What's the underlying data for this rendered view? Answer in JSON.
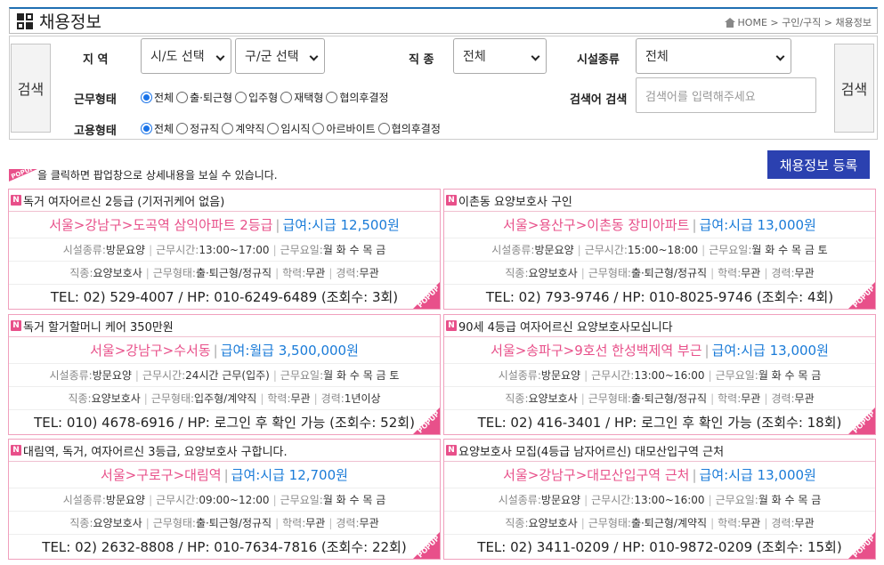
{
  "header": {
    "title": "채용정보",
    "breadcrumb": "HOME > 구인/구직 > 채용정보"
  },
  "search": {
    "button_label": "검색",
    "region_label": "지 역",
    "region_sido": "시/도 선택",
    "region_gugun": "구/군 선택",
    "job_label": "직 종",
    "job_value": "전체",
    "facility_label": "시설종류",
    "facility_value": "전체",
    "worktype_label": "근무형태",
    "worktype_options": [
      "전체",
      "출·퇴근형",
      "입주형",
      "재택형",
      "협의후결정"
    ],
    "keyword_label": "검색어 검색",
    "keyword_placeholder": "검색어를 입력해주세요",
    "employ_label": "고용형태",
    "employ_options": [
      "전체",
      "정규직",
      "계약직",
      "임시직",
      "아르바이트",
      "협의후결정"
    ]
  },
  "notice": "을 클릭하면 팝업창으로 상세내용을 보실 수 있습니다.",
  "popup_badge": "POPUP",
  "register_button": "채용정보 등록",
  "field_labels": {
    "facility": "시설종류:",
    "hours": "근무시간:",
    "days": "근무요일:",
    "job": "직종:",
    "worktype": "근무형태:",
    "edu": "학력:",
    "career": "경력:"
  },
  "new_badge": "N",
  "colors": {
    "accent_pink": "#e8508a",
    "wage_blue": "#1a7bd8",
    "register_bg": "#2b41b0"
  },
  "cards": [
    {
      "title": "독거 여자어르신 2등급 (기저귀케어 없음)",
      "location": "서울>강남구>도곡역 삼익아파트 2등급",
      "wage": "급여:시급 12,500원",
      "facility": "방문요양",
      "hours": "13:00~17:00",
      "days": "월 화 수 목 금",
      "job": "요양보호사",
      "worktype": "출·퇴근형/정규직",
      "edu": "무관",
      "career": "무관",
      "tel": "TEL: 02) 529-4007 / HP: 010-6249-6489 (조회수: 3회)"
    },
    {
      "title": "이촌동 요양보호사 구인",
      "location": "서울>용산구>이촌동 장미아파트",
      "wage": "급여:시급 13,000원",
      "facility": "방문요양",
      "hours": "15:00~18:00",
      "days": "월 화 수 목 금 토",
      "job": "요양보호사",
      "worktype": "출·퇴근형/정규직",
      "edu": "무관",
      "career": "무관",
      "tel": "TEL: 02) 793-9746 / HP: 010-8025-9746 (조회수: 4회)"
    },
    {
      "title": "독거 할거할머니 케어 350만원",
      "location": "서울>강남구>수서동",
      "wage": "급여:월급 3,500,000원",
      "facility": "방문요양",
      "hours": "24시간 근무(입주)",
      "days": "월 화 수 목 금 토",
      "job": "요양보호사",
      "worktype": "입주형/계약직",
      "edu": "무관",
      "career": "1년이상",
      "tel": "TEL: 010) 4678-6916 / HP: 로그인 후 확인 가능 (조회수: 52회)"
    },
    {
      "title": "90세 4등급 여자어르신 요양보호사모십니다",
      "location": "서울>송파구>9호선 한성백제역 부근",
      "wage": "급여:시급 13,000원",
      "facility": "방문요양",
      "hours": "13:00~16:00",
      "days": "월 화 수 목 금",
      "job": "요양보호사",
      "worktype": "출·퇴근형/정규직",
      "edu": "무관",
      "career": "무관",
      "tel": "TEL: 02) 416-3401 / HP: 로그인 후 확인 가능 (조회수: 18회)"
    },
    {
      "title": "대림역, 독거, 여자어르신 3등급, 요양보호사 구합니다.",
      "location": "서울>구로구>대림역",
      "wage": "급여:시급 12,700원",
      "facility": "방문요양",
      "hours": "09:00~12:00",
      "days": "월 화 수 목 금",
      "job": "요양보호사",
      "worktype": "출·퇴근형/정규직",
      "edu": "무관",
      "career": "무관",
      "tel": "TEL: 02) 2632-8808 / HP: 010-7634-7816 (조회수: 22회)"
    },
    {
      "title": "요양보호사 모집(4등급 남자어르신) 대모산입구역 근처",
      "location": "서울>강남구>대모산입구역 근처",
      "wage": "급여:시급 13,000원",
      "facility": "방문요양",
      "hours": "13:00~16:00",
      "days": "월 화 수 목 금",
      "job": "요양보호사",
      "worktype": "출·퇴근형/계약직",
      "edu": "무관",
      "career": "무관",
      "tel": "TEL: 02) 3411-0209 / HP: 010-9872-0209 (조회수: 15회)"
    }
  ]
}
